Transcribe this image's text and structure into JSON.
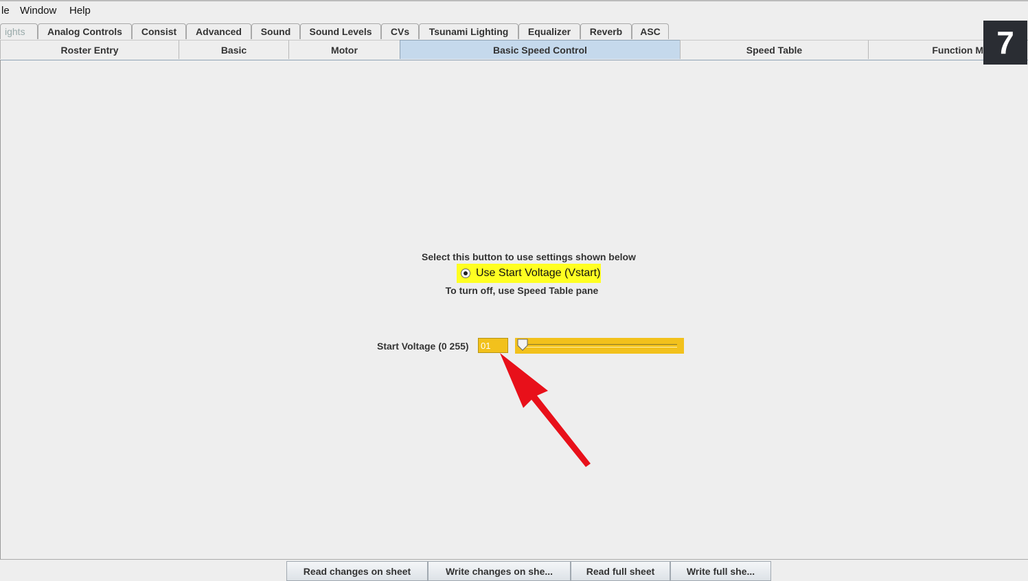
{
  "menu": [
    "le",
    "Window",
    "Help"
  ],
  "tabs_row1": [
    "ights",
    "Analog Controls",
    "Consist",
    "Advanced",
    "Sound",
    "Sound Levels",
    "CVs",
    "Tsunami Lighting",
    "Equalizer",
    "Reverb",
    "ASC"
  ],
  "tabs_row2": [
    "Roster Entry",
    "Basic",
    "Motor",
    "Basic Speed Control",
    "Speed Table",
    "Function M"
  ],
  "active_tab": "Basic Speed Control",
  "badge": "7",
  "panel": {
    "instruction": "Select this button to use settings shown below",
    "radio_label": "Use Start Voltage (Vstart)",
    "radio_selected": true,
    "note": "To turn off, use Speed Table pane",
    "start_voltage_label": "Start Voltage (0 255)",
    "start_voltage_value": "01",
    "slider_value": 1,
    "slider_max": 255
  },
  "buttons": [
    "Read changes on sheet",
    "Write changes on she...",
    "Read full sheet",
    "Write full she..."
  ],
  "colors": {
    "highlight": "#ffff22",
    "field": "#f2c11c",
    "active_tab": "#c5d9ec",
    "arrow": "#e8101a"
  }
}
